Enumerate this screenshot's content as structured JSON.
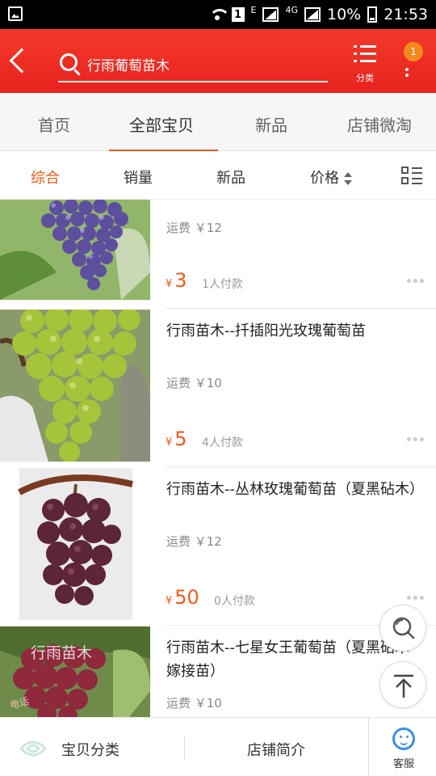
{
  "status_bar": {
    "sim_label": "1",
    "network_label": "E",
    "network2_label": "4G",
    "battery": "10%",
    "time": "21:53"
  },
  "header": {
    "search_text": "行雨葡萄苗木",
    "category_label": "分类",
    "badge_count": "1",
    "accent_color": "#ef2524"
  },
  "tabs": [
    {
      "label": "首页"
    },
    {
      "label": "全部宝贝"
    },
    {
      "label": "新品"
    },
    {
      "label": "店铺微淘"
    }
  ],
  "active_tab": "全部宝贝",
  "sort_options": [
    {
      "label": "综合"
    },
    {
      "label": "销量"
    },
    {
      "label": "新品"
    },
    {
      "label": "价格"
    }
  ],
  "active_sort": "综合",
  "products": [
    {
      "title": "",
      "shipping": "运费 ￥12",
      "currency": "¥",
      "price": "3",
      "sold": "1人付款"
    },
    {
      "title": "行雨苗木--扦插阳光玫瑰葡萄苗",
      "shipping": "运费 ￥10",
      "currency": "¥",
      "price": "5",
      "sold": "4人付款"
    },
    {
      "title": "行雨苗木--丛林玫瑰葡萄苗（夏黑砧木）",
      "shipping": "运费 ￥12",
      "currency": "¥",
      "price": "50",
      "sold": "0人付款"
    },
    {
      "title": "行雨苗木--七星女王葡萄苗（夏黑砧木嫁接苗）",
      "shipping": "运费 ￥10",
      "watermark": "行雨苗木",
      "watermark2": "电话"
    }
  ],
  "bottom_bar": {
    "category": "宝贝分类",
    "intro": "店铺简介",
    "service": "客服"
  }
}
